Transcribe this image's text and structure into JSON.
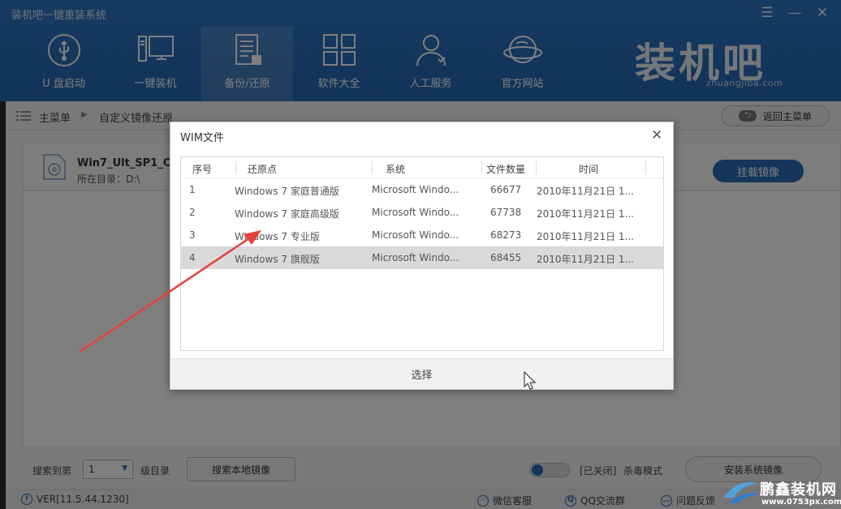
{
  "app": {
    "title": "装机吧一键重装系统",
    "brand": "装机吧",
    "brand_url": "zhuangjiba.com",
    "menu_icon": "☰",
    "minimize_icon": "—",
    "close_icon": "✕"
  },
  "nav": [
    {
      "label": "U 盘启动",
      "icon": "usb-icon"
    },
    {
      "label": "一键装机",
      "icon": "computer-icon"
    },
    {
      "label": "备份/还原",
      "icon": "backup-icon"
    },
    {
      "label": "软件大全",
      "icon": "apps-grid-icon"
    },
    {
      "label": "人工服务",
      "icon": "user-service-icon"
    },
    {
      "label": "官方网站",
      "icon": "globe-icon"
    }
  ],
  "breadcrumb": {
    "home": "主菜单",
    "current": "自定义镜像还原",
    "back_button": "返回主菜单"
  },
  "file": {
    "name": "Win7_Ult_SP1_Ch",
    "dir": "所在目录：D:\\",
    "mount_button": "挂载镜像"
  },
  "bottom": {
    "search_depth_label": "搜索到第",
    "depth_value": "1",
    "level_label": "级目录",
    "search_local_button": "搜索本地镜像",
    "toggle_state": "[已关闭]",
    "antivirus_label": "杀毒模式",
    "install_button": "安装系统镜像"
  },
  "status": {
    "version": "VER[11.5.44.1230]",
    "wechat": "微信客服",
    "qq": "QQ交流群",
    "feedback": "问题反馈"
  },
  "dialog": {
    "title": "WIM文件",
    "close": "✕",
    "columns": [
      "序号",
      "还原点",
      "系统",
      "文件数量",
      "时间"
    ],
    "rows": [
      {
        "idx": "1",
        "restore": "Windows 7 家庭普通版",
        "system": "Microsoft  Windo...",
        "count": "66677",
        "time": "2010年11月21日 1..."
      },
      {
        "idx": "2",
        "restore": "Windows 7 家庭高级版",
        "system": "Microsoft  Windo...",
        "count": "67738",
        "time": "2010年11月21日 1..."
      },
      {
        "idx": "3",
        "restore": "Windows 7 专业版",
        "system": "Microsoft  Windo...",
        "count": "68273",
        "time": "2010年11月21日 1..."
      },
      {
        "idx": "4",
        "restore": "Windows 7 旗舰版",
        "system": "Microsoft  Windo...",
        "count": "68455",
        "time": "2010年11月21日 1..."
      }
    ],
    "selected_row": 4,
    "select_button": "选择"
  },
  "watermark": {
    "text": "鹏鑫装机网",
    "url": "www.0753px.com"
  },
  "colors": {
    "header_blue": "#2566b0",
    "accent_blue": "#2b6cb5",
    "annotation_arrow": "#e8403a"
  }
}
